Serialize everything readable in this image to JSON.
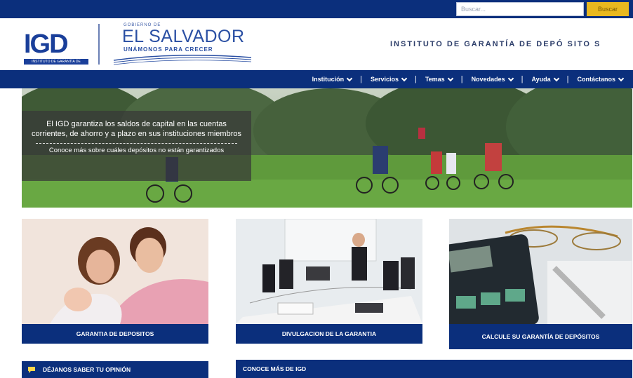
{
  "topbar": {
    "search_placeholder": "Buscar...",
    "search_button": "Buscar"
  },
  "header": {
    "logo_text": "IGD",
    "logo_subtext": "INSTITUTO DE GARANTÍA DE DEPÓSITOS",
    "gov_small": "GOBIERNO DE",
    "gov_name": "EL SALVADOR",
    "gov_slogan": "UNÁMONOS PARA CRECER",
    "institute_title": "INSTITUTO DE GARANTÍA DE DEPÓ SITO S"
  },
  "nav": {
    "items": [
      {
        "label": "Institución"
      },
      {
        "label": "Servicios"
      },
      {
        "label": "Temas"
      },
      {
        "label": "Novedades"
      },
      {
        "label": "Ayuda"
      },
      {
        "label": "Contáctanos"
      }
    ],
    "separator": "|"
  },
  "hero": {
    "main_text": "El IGD garantiza los saldos de capital en las cuentas corrientes, de ahorro y a plazo en sus instituciones miembros",
    "link_text": "Conoce más sobre cuáles depósitos no están garantizados"
  },
  "cards": [
    {
      "label": "GARANTIA DE DEPOSITOS"
    },
    {
      "label": "DIVULGACION DE LA GARANTIA"
    },
    {
      "label": "CALCULE SU GARANTÍA DE DEPÓSITOS"
    }
  ],
  "bottom": {
    "opinion_label": "DÉJANOS SABER TU OPINIÓN",
    "know_more_label": "CONOCE MÁS DE IGD"
  },
  "colors": {
    "brand_blue": "#0b2f7c",
    "search_button": "#e8b81f"
  }
}
